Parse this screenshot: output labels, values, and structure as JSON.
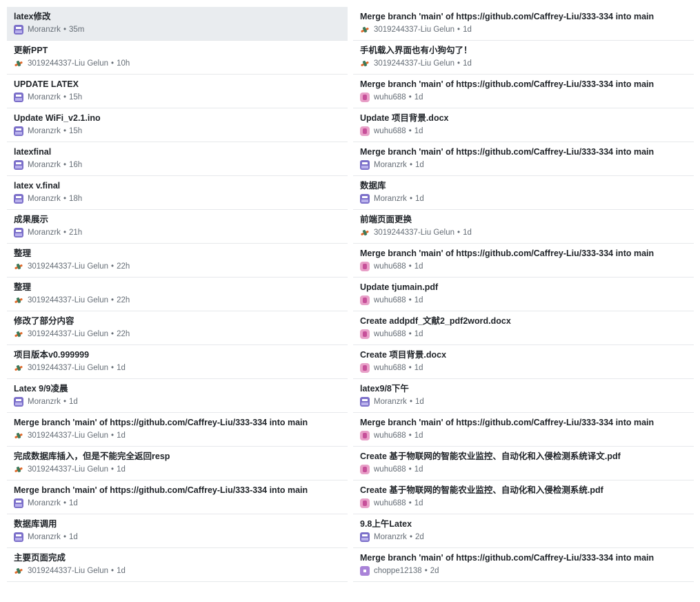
{
  "commits_left": [
    {
      "message": "latex修改",
      "author": "Moranzrk",
      "avatar_icon": "moranzrk-avatar-icon",
      "time": "35m",
      "selected": true
    },
    {
      "message": "更新PPT",
      "author": "3019244337-Liu Gelun",
      "avatar_icon": "liu-gelun-avatar-icon",
      "time": "10h"
    },
    {
      "message": "UPDATE LATEX",
      "author": "Moranzrk",
      "avatar_icon": "moranzrk-avatar-icon",
      "time": "15h"
    },
    {
      "message": "Update WiFi_v2.1.ino",
      "author": "Moranzrk",
      "avatar_icon": "moranzrk-avatar-icon",
      "time": "15h"
    },
    {
      "message": "latexfinal",
      "author": "Moranzrk",
      "avatar_icon": "moranzrk-avatar-icon",
      "time": "16h"
    },
    {
      "message": "latex v.final",
      "author": "Moranzrk",
      "avatar_icon": "moranzrk-avatar-icon",
      "time": "18h"
    },
    {
      "message": "成果展示",
      "author": "Moranzrk",
      "avatar_icon": "moranzrk-avatar-icon",
      "time": "21h"
    },
    {
      "message": "整理",
      "author": "3019244337-Liu Gelun",
      "avatar_icon": "liu-gelun-avatar-icon",
      "time": "22h"
    },
    {
      "message": "整理",
      "author": "3019244337-Liu Gelun",
      "avatar_icon": "liu-gelun-avatar-icon",
      "time": "22h"
    },
    {
      "message": "修改了部分内容",
      "author": "3019244337-Liu Gelun",
      "avatar_icon": "liu-gelun-avatar-icon",
      "time": "22h"
    },
    {
      "message": "项目版本v0.999999",
      "author": "3019244337-Liu Gelun",
      "avatar_icon": "liu-gelun-avatar-icon",
      "time": "1d"
    },
    {
      "message": "Latex 9/9凌晨",
      "author": "Moranzrk",
      "avatar_icon": "moranzrk-avatar-icon",
      "time": "1d"
    },
    {
      "message": "Merge branch 'main' of https://github.com/Caffrey-Liu/333-334 into main",
      "author": "3019244337-Liu Gelun",
      "avatar_icon": "liu-gelun-avatar-icon",
      "time": "1d"
    },
    {
      "message": "完成数据库插入，但是不能完全返回resp",
      "author": "3019244337-Liu Gelun",
      "avatar_icon": "liu-gelun-avatar-icon",
      "time": "1d"
    },
    {
      "message": "Merge branch 'main' of https://github.com/Caffrey-Liu/333-334 into main",
      "author": "Moranzrk",
      "avatar_icon": "moranzrk-avatar-icon",
      "time": "1d"
    },
    {
      "message": "数据库调用",
      "author": "Moranzrk",
      "avatar_icon": "moranzrk-avatar-icon",
      "time": "1d"
    },
    {
      "message": "主要页面完成",
      "author": "3019244337-Liu Gelun",
      "avatar_icon": "liu-gelun-avatar-icon",
      "time": "1d"
    }
  ],
  "commits_right": [
    {
      "message": "Merge branch 'main' of https://github.com/Caffrey-Liu/333-334 into main",
      "author": "3019244337-Liu Gelun",
      "avatar_icon": "liu-gelun-avatar-icon",
      "time": "1d"
    },
    {
      "message": "手机载入界面也有小狗勾了！",
      "author": "3019244337-Liu Gelun",
      "avatar_icon": "liu-gelun-avatar-icon",
      "time": "1d"
    },
    {
      "message": "Merge branch 'main' of https://github.com/Caffrey-Liu/333-334 into main",
      "author": "wuhu688",
      "avatar_icon": "wuhu688-avatar-icon",
      "time": "1d"
    },
    {
      "message": "Update 项目背景.docx",
      "author": "wuhu688",
      "avatar_icon": "wuhu688-avatar-icon",
      "time": "1d"
    },
    {
      "message": "Merge branch 'main' of https://github.com/Caffrey-Liu/333-334 into main",
      "author": "Moranzrk",
      "avatar_icon": "moranzrk-avatar-icon",
      "time": "1d"
    },
    {
      "message": "数据库",
      "author": "Moranzrk",
      "avatar_icon": "moranzrk-avatar-icon",
      "time": "1d"
    },
    {
      "message": "前端页面更换",
      "author": "3019244337-Liu Gelun",
      "avatar_icon": "liu-gelun-avatar-icon",
      "time": "1d"
    },
    {
      "message": "Merge branch 'main' of https://github.com/Caffrey-Liu/333-334 into main",
      "author": "wuhu688",
      "avatar_icon": "wuhu688-avatar-icon",
      "time": "1d"
    },
    {
      "message": "Update tjumain.pdf",
      "author": "wuhu688",
      "avatar_icon": "wuhu688-avatar-icon",
      "time": "1d"
    },
    {
      "message": "Create addpdf_文献2_pdf2word.docx",
      "author": "wuhu688",
      "avatar_icon": "wuhu688-avatar-icon",
      "time": "1d"
    },
    {
      "message": "Create 项目背景.docx",
      "author": "wuhu688",
      "avatar_icon": "wuhu688-avatar-icon",
      "time": "1d"
    },
    {
      "message": "latex9/8下午",
      "author": "Moranzrk",
      "avatar_icon": "moranzrk-avatar-icon",
      "time": "1d"
    },
    {
      "message": "Merge branch 'main' of https://github.com/Caffrey-Liu/333-334 into main",
      "author": "wuhu688",
      "avatar_icon": "wuhu688-avatar-icon",
      "time": "1d"
    },
    {
      "message": "Create 基于物联网的智能农业监控、自动化和入侵检测系统译文.pdf",
      "author": "wuhu688",
      "avatar_icon": "wuhu688-avatar-icon",
      "time": "1d"
    },
    {
      "message": "Create 基于物联网的智能农业监控、自动化和入侵检测系统.pdf",
      "author": "wuhu688",
      "avatar_icon": "wuhu688-avatar-icon",
      "time": "1d"
    },
    {
      "message": "9.8上午Latex",
      "author": "Moranzrk",
      "avatar_icon": "moranzrk-avatar-icon",
      "time": "2d"
    },
    {
      "message": "Merge branch 'main' of https://github.com/Caffrey-Liu/333-334 into main",
      "author": "choppe12138",
      "avatar_icon": "choppe12138-avatar-icon",
      "time": "2d"
    }
  ],
  "separator": "•"
}
